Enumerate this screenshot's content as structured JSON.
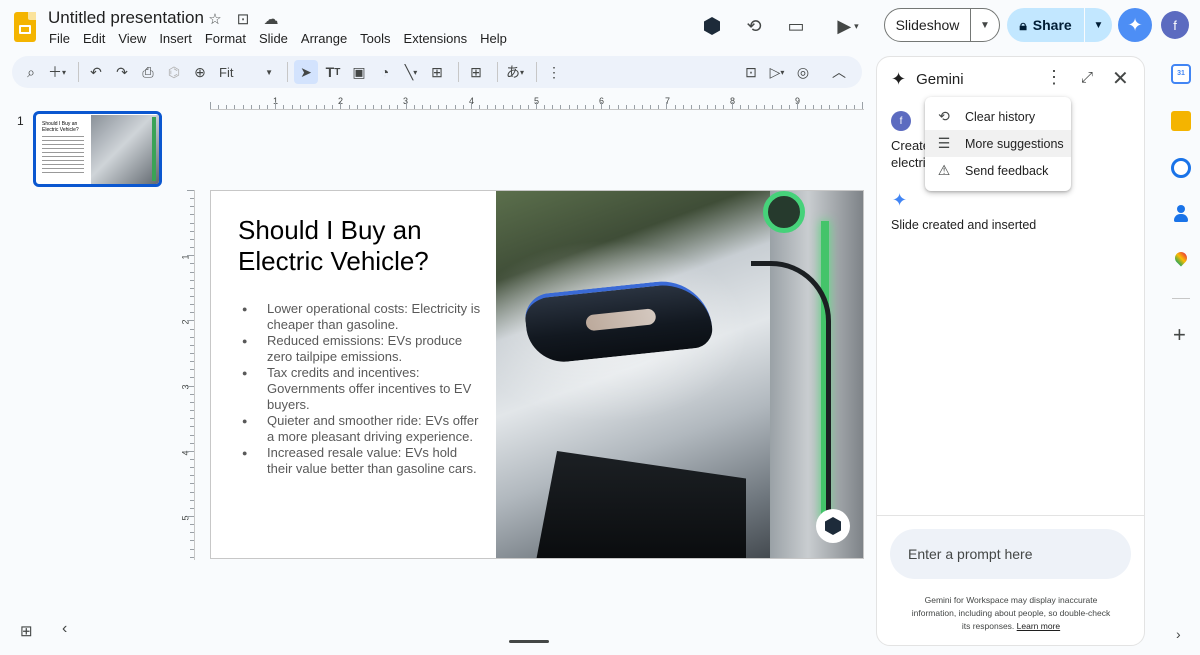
{
  "header": {
    "doc_title": "Untitled presentation",
    "menu": [
      "File",
      "Edit",
      "View",
      "Insert",
      "Format",
      "Slide",
      "Arrange",
      "Tools",
      "Extensions",
      "Help"
    ],
    "slideshow_label": "Slideshow",
    "share_label": "Share",
    "avatar_initial": "f"
  },
  "toolbar": {
    "zoom_value": "Fit",
    "icons": [
      "search-icon",
      "new-slide-icon",
      "undo-icon",
      "redo-icon",
      "print-icon",
      "paint-format-icon",
      "zoom-icon",
      "select-icon",
      "text-box-icon",
      "image-icon",
      "shape-icon",
      "line-icon",
      "video-icon",
      "comment-icon",
      "input-tools-icon",
      "more-icon",
      "insert-image-icon",
      "pointer-icon",
      "animation-icon",
      "collapse-icon"
    ]
  },
  "filmstrip": {
    "slide_number": "1",
    "thumb_title": "Should I Buy an Electric Vehicle?"
  },
  "ruler": {
    "h_labels": [
      "1",
      "2",
      "3",
      "4",
      "5",
      "6",
      "7",
      "8",
      "9"
    ],
    "v_labels": [
      "1",
      "2",
      "3",
      "4",
      "5"
    ]
  },
  "slide": {
    "title": "Should I Buy an Electric Vehicle?",
    "bullets": [
      "Lower operational costs: Electricity is cheaper than gasoline.",
      "Reduced emissions: EVs produce zero tailpipe emissions.",
      "Tax credits and incentives: Governments offer incentives to EV buyers.",
      "Quieter and smoother ride: EVs offer a more pleasant driving experience.",
      "Increased resale value: EVs hold their value better than gasoline cars."
    ]
  },
  "gemini": {
    "title": "Gemini",
    "user_initial": "f",
    "prompt_line1": "Create",
    "prompt_line2": "electri",
    "response": "Slide created and inserted",
    "menu": [
      "Clear history",
      "More suggestions",
      "Send feedback"
    ],
    "input_placeholder": "Enter a prompt here",
    "disclaimer": "Gemini for Workspace may display inaccurate information, including about people, so double-check its responses.",
    "learn_more": "Learn more"
  },
  "rail": {
    "calendar_text": "31"
  },
  "colors": {
    "accent": "#0b57d0",
    "share_bg": "#c2e7ff",
    "gemini_blue": "#4285f4",
    "app_logo": "#f4b400"
  }
}
